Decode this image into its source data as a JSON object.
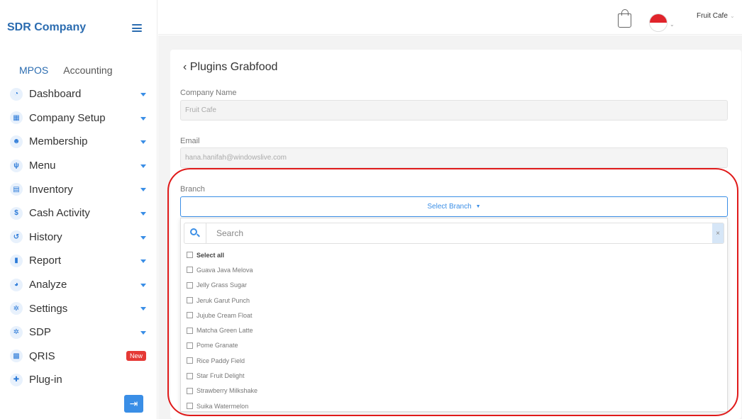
{
  "sidebar": {
    "brand": "SDR Company",
    "tabs": [
      {
        "label": "MPOS",
        "active": true
      },
      {
        "label": "Accounting",
        "active": false
      }
    ],
    "items": [
      {
        "label": "Dashboard",
        "icon": "dashboard-icon",
        "glyph": "◔"
      },
      {
        "label": "Company Setup",
        "icon": "building-icon",
        "glyph": "▦"
      },
      {
        "label": "Membership",
        "icon": "users-icon",
        "glyph": "☻"
      },
      {
        "label": "Menu",
        "icon": "utensils-icon",
        "glyph": "ψ"
      },
      {
        "label": "Inventory",
        "icon": "inventory-icon",
        "glyph": "▤"
      },
      {
        "label": "Cash Activity",
        "icon": "dollar-icon",
        "glyph": "$"
      },
      {
        "label": "History",
        "icon": "history-icon",
        "glyph": "↺"
      },
      {
        "label": "Report",
        "icon": "file-icon",
        "glyph": "▮"
      },
      {
        "label": "Analyze",
        "icon": "pie-chart-icon",
        "glyph": "◕"
      },
      {
        "label": "Settings",
        "icon": "gear-icon",
        "glyph": "✲"
      },
      {
        "label": "SDP",
        "icon": "gear-icon",
        "glyph": "✲"
      },
      {
        "label": "QRIS",
        "icon": "qr-icon",
        "glyph": "▩",
        "badge": "New"
      },
      {
        "label": "Plug-in",
        "icon": "plug-icon",
        "glyph": "✚"
      }
    ]
  },
  "topbar": {
    "user": "Fruit Cafe"
  },
  "page": {
    "title": "Plugins Grabfood",
    "company_label": "Company Name",
    "company_value": "Fruit Cafe",
    "email_label": "Email",
    "email_value": "hana.hanifah@windowslive.com",
    "branch_label": "Branch",
    "branch_placeholder": "Select Branch"
  },
  "dropdown": {
    "search_placeholder": "Search",
    "clear": "×",
    "select_all": "Select all",
    "options": [
      "Guava Java Melova",
      "Jelly Grass Sugar",
      "Jeruk Garut Punch",
      "Jujube Cream Float",
      "Matcha Green Latte",
      "Pome Granate",
      "Rice Paddy Field",
      "Star Fruit Delight",
      "Strawberry Milkshake",
      "Suika Watermelon"
    ]
  },
  "colors": {
    "accent": "#3a8ee6",
    "brand": "#2b6cb0",
    "highlight": "#e01a1a",
    "badge": "#e53935"
  }
}
